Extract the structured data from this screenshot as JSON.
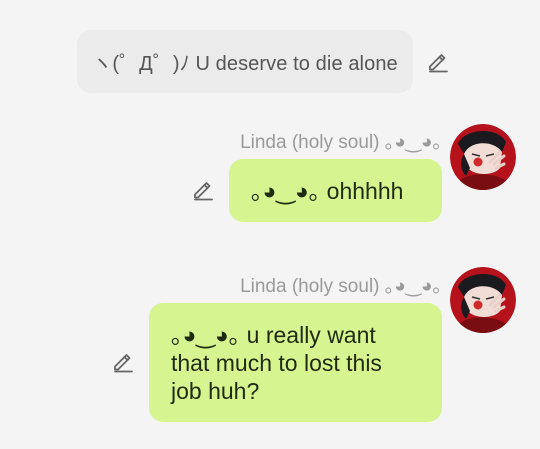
{
  "messages": [
    {
      "text": "ヽ(゜Д゜)ﾉ U deserve to die alone",
      "edit_icon": "pencil-edit-icon"
    },
    {
      "sender": "Linda (holy soul) ｡◕‿◕｡",
      "text": "｡◕‿◕｡ ohhhhh",
      "avatar": "anime-avatar",
      "edit_icon": "pencil-edit-icon"
    },
    {
      "sender": "Linda (holy soul) ｡◕‿◕｡",
      "text_lines": [
        "｡◕‿◕｡ u really want",
        "that much to lost this",
        "job huh?"
      ],
      "avatar": "anime-avatar",
      "edit_icon": "pencil-edit-icon"
    }
  ],
  "colors": {
    "background": "#f4f4f4",
    "other_bubble": "#ebebeb",
    "my_bubble": "#d6f590",
    "sender_name": "#9a9a9a",
    "avatar_red": "#b5121b"
  }
}
